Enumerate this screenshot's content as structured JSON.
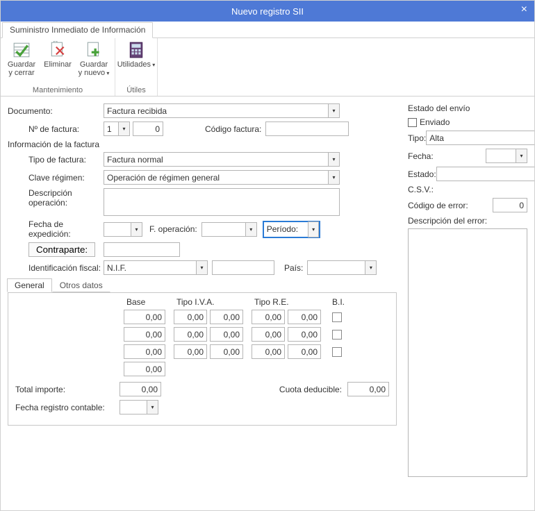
{
  "window": {
    "title": "Nuevo registro SII"
  },
  "doc_tab": "Suministro Inmediato de Información",
  "ribbon": {
    "group1": {
      "name": "Mantenimiento",
      "save_close": "Guardar\ny cerrar",
      "delete": "Eliminar",
      "save_new": "Guardar\ny nuevo"
    },
    "group2": {
      "name": "Útiles",
      "utilities": "Utilidades"
    }
  },
  "form": {
    "documento_label": "Documento:",
    "documento_value": "Factura recibida",
    "n_factura_label": "Nº de factura:",
    "n_factura_serie": "1",
    "n_factura_num": "0",
    "cod_factura_label": "Código factura:",
    "cod_factura_value": "",
    "info_header": "Información de la factura",
    "tipo_factura_label": "Tipo de factura:",
    "tipo_factura_value": "Factura normal",
    "clave_label": "Clave régimen:",
    "clave_value": "Operación de régimen general",
    "desc_label": "Descripción operación:",
    "desc_value": "",
    "fecha_exp_label": "Fecha de expedición:",
    "fecha_exp_value": "",
    "f_operacion_label": "F. operación:",
    "f_operacion_value": "",
    "periodo_label": "Período:",
    "periodo_value": "",
    "contraparte_btn": "Contraparte:",
    "contraparte_value": "",
    "ident_label": "Identificación fiscal:",
    "ident_type": "N.I.F.",
    "ident_value": "",
    "pais_label": "País:",
    "pais_value": "",
    "tabs": {
      "general": "General",
      "otros": "Otros datos"
    },
    "grid": {
      "head_base": "Base",
      "head_iva": "Tipo I.V.A.",
      "head_re": "Tipo R.E.",
      "head_bi": "B.I.",
      "rows": [
        {
          "base": "0,00",
          "iva_t": "0,00",
          "iva_c": "0,00",
          "re_t": "0,00",
          "re_c": "0,00",
          "bi": false
        },
        {
          "base": "0,00",
          "iva_t": "0,00",
          "iva_c": "0,00",
          "re_t": "0,00",
          "re_c": "0,00",
          "bi": false
        },
        {
          "base": "0,00",
          "iva_t": "0,00",
          "iva_c": "0,00",
          "re_t": "0,00",
          "re_c": "0,00",
          "bi": false
        }
      ],
      "base_total": "0,00"
    },
    "total_label": "Total importe:",
    "total_value": "0,00",
    "cuota_label": "Cuota deducible:",
    "cuota_value": "0,00",
    "fecha_reg_label": "Fecha registro contable:",
    "fecha_reg_value": ""
  },
  "side": {
    "header": "Estado del envío",
    "enviado": "Enviado",
    "tipo_label": "Tipo:",
    "tipo_value": "Alta",
    "fecha_label": "Fecha:",
    "fecha_value": "",
    "estado_label": "Estado:",
    "estado_value": "",
    "csv_label": "C.S.V.:",
    "csv_value": "",
    "cod_err_label": "Código de error:",
    "cod_err_value": "0",
    "desc_err_label": "Descripción del error:"
  }
}
